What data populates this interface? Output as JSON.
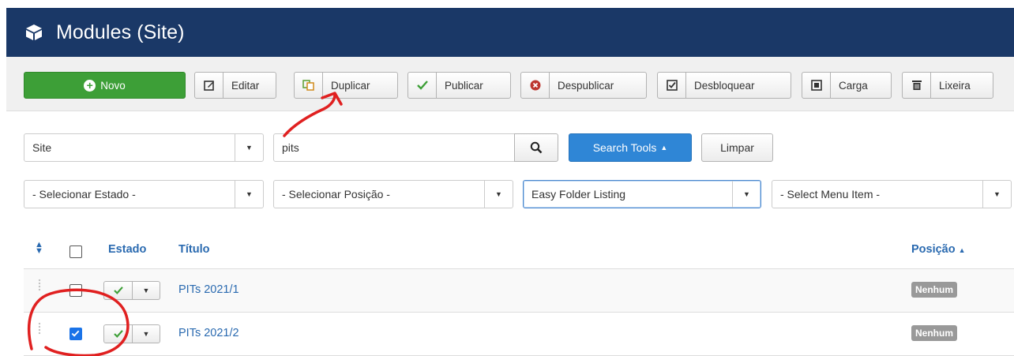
{
  "header": {
    "title": "Modules (Site)",
    "icon": "cube-icon"
  },
  "toolbar": {
    "new_label": "Novo",
    "buttons": [
      {
        "label": "Editar",
        "icon": "edit-icon"
      },
      {
        "label": "Duplicar",
        "icon": "copy-icon"
      },
      {
        "label": "Publicar",
        "icon": "checkmark-icon"
      },
      {
        "label": "Despublicar",
        "icon": "unpublish-icon"
      },
      {
        "label": "Desbloquear",
        "icon": "checkbox-icon"
      },
      {
        "label": "Carga",
        "icon": "square-icon"
      },
      {
        "label": "Lixeira",
        "icon": "trash-icon"
      }
    ]
  },
  "filters": {
    "client": "Site",
    "search_value": "pits",
    "search_tools_label": "Search Tools",
    "clear_label": "Limpar",
    "state": "- Selecionar Estado -",
    "position": "- Selecionar Posição -",
    "type": "Easy Folder Listing",
    "menu_item": "- Select Menu Item -"
  },
  "table": {
    "columns": {
      "state": "Estado",
      "title": "Título",
      "position": "Posição"
    },
    "rows": [
      {
        "title": "PITs 2021/1",
        "position": "Nenhum",
        "checked": false,
        "published": true
      },
      {
        "title": "PITs 2021/2",
        "position": "Nenhum",
        "checked": true,
        "published": true
      }
    ]
  },
  "colors": {
    "header_bg": "#1a3867",
    "new_button": "#3d9f37",
    "search_tools_button": "#2f86d6",
    "link": "#2a6ab0",
    "annotation": "#e02020"
  }
}
